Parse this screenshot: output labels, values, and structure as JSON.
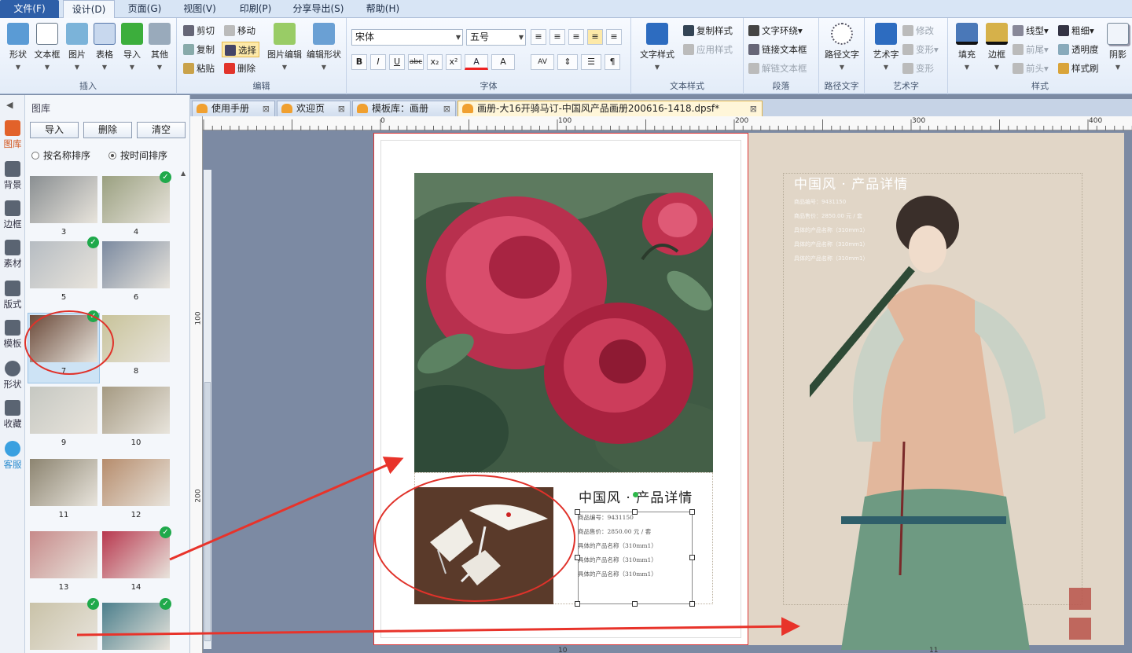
{
  "menu": {
    "file": "文件(F)",
    "design": "设计(D)",
    "page": "页面(G)",
    "view": "视图(V)",
    "print": "印刷(P)",
    "share": "分享导出(S)",
    "help": "帮助(H)"
  },
  "ribbon": {
    "insert": {
      "label": "插入",
      "shape": "形状",
      "textbox": "文本框",
      "image": "图片",
      "table": "表格",
      "import": "导入",
      "other": "其他"
    },
    "edit": {
      "label": "编辑",
      "cut": "剪切",
      "move": "移动",
      "copy": "复制",
      "select": "选择",
      "paste": "粘贴",
      "delete": "删除",
      "image_edit": "图片编辑",
      "edit_shape": "编辑形状"
    },
    "font": {
      "label": "字体",
      "family": "宋体",
      "size": "五号",
      "bold": "B",
      "italic": "I",
      "underline": "U",
      "strike": "abc",
      "sub": "x₂",
      "sup": "x²",
      "color": "A",
      "highlight": "A",
      "spacing": "AV"
    },
    "text_style": {
      "label": "文本样式",
      "art_text": "文字样式",
      "copy_style": "复制样式",
      "apply_style": "应用样式"
    },
    "paragraph": {
      "label": "段落",
      "wrap": "文字环绕",
      "link": "链接文本框",
      "unlink": "解链文本框"
    },
    "path_text": {
      "label": "路径文字",
      "name": "路径文字"
    },
    "art": {
      "label": "艺术字",
      "name": "艺术字",
      "modify": "修改",
      "transform": "变形",
      "deform": "变形"
    },
    "style": {
      "label": "样式",
      "fill": "填充",
      "border": "边框",
      "line_type": "线型",
      "thickness": "粗细",
      "front_arrow": "前尾",
      "rear_arrow": "前头",
      "transparency": "透明度",
      "brush": "样式刷",
      "shadow": "阴影"
    }
  },
  "sidebar": {
    "tabs": [
      {
        "label": "图库",
        "icon": "gallery-icon"
      },
      {
        "label": "背景",
        "icon": "background-icon"
      },
      {
        "label": "边框",
        "icon": "border-icon"
      },
      {
        "label": "素材",
        "icon": "material-icon"
      },
      {
        "label": "版式",
        "icon": "layout-icon"
      },
      {
        "label": "模板",
        "icon": "template-icon"
      },
      {
        "label": "形状",
        "icon": "shape-icon"
      },
      {
        "label": "收藏",
        "icon": "star-icon"
      },
      {
        "label": "客服",
        "icon": "chat-icon"
      }
    ]
  },
  "library": {
    "title": "图库",
    "import": "导入",
    "delete": "删除",
    "clear": "清空",
    "sort_by_name": "按名称排序",
    "sort_by_time": "按时间排序",
    "thumbs": [
      {
        "num": "3",
        "checked": false,
        "color": "#8a8f92"
      },
      {
        "num": "4",
        "checked": true,
        "color": "#9aa080"
      },
      {
        "num": "5",
        "checked": true,
        "color": "#b6bcc2"
      },
      {
        "num": "6",
        "checked": false,
        "color": "#7b8aa0"
      },
      {
        "num": "7",
        "checked": true,
        "color": "#6b4a3a"
      },
      {
        "num": "8",
        "checked": false,
        "color": "#c8c39a"
      },
      {
        "num": "9",
        "checked": false,
        "color": "#c6c8c2"
      },
      {
        "num": "10",
        "checked": false,
        "color": "#a59a82"
      },
      {
        "num": "11",
        "checked": false,
        "color": "#8c8470"
      },
      {
        "num": "12",
        "checked": false,
        "color": "#b68c6c"
      },
      {
        "num": "13",
        "checked": false,
        "color": "#c78a8a"
      },
      {
        "num": "14",
        "checked": true,
        "color": "#b8384f"
      },
      {
        "num": "",
        "checked": true,
        "color": "#c9c2a8"
      },
      {
        "num": "",
        "checked": true,
        "color": "#4c7f8c"
      }
    ]
  },
  "tabs": [
    {
      "label": "使用手册"
    },
    {
      "label": "欢迎页"
    },
    {
      "label": "模板库：画册"
    },
    {
      "label": "画册-大16开骑马订-中国风产品画册200616-1418.dpsf*"
    }
  ],
  "ruler": {
    "h": [
      "0",
      "100",
      "200",
      "300",
      "400"
    ],
    "v": [
      "100",
      "200"
    ]
  },
  "page_numbers": {
    "left": "10",
    "right": "11"
  },
  "left_page": {
    "title": "中国风 · 产品详情",
    "lines": [
      "商品编号：9431150",
      "商品售价：2850.00 元 / 套",
      "具体的产品名称（310mm1）",
      "具体的产品名称（310mm1）",
      "具体的产品名称（310mm1）"
    ]
  },
  "right_page": {
    "title": "中国风 · 产品详情",
    "lines": [
      "商品编号：9431150",
      "商品售价：2850.00 元 / 套",
      "具体的产品名称（310mm1）",
      "具体的产品名称（310mm1）",
      "具体的产品名称（310mm1）"
    ]
  }
}
